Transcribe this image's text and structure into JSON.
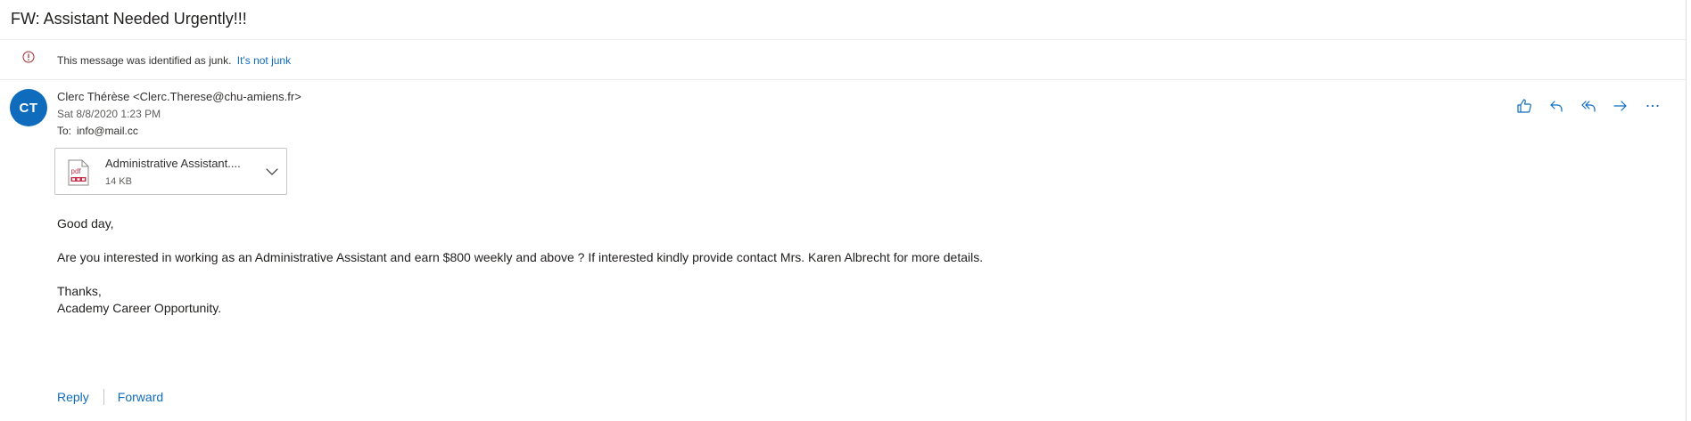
{
  "message": {
    "subject": "FW: Assistant Needed Urgently!!!",
    "junk_notice": {
      "text": "This message was identified as junk.",
      "link": "It's not junk",
      "icon": "info-icon"
    },
    "sender": {
      "initials": "CT",
      "display": "Clerc Thérèse <Clerc.Therese@chu-amiens.fr>",
      "avatar_color": "#0f6cbd"
    },
    "date": "Sat 8/8/2020 1:23 PM",
    "to": {
      "label": "To:",
      "address": "info@mail.cc"
    },
    "actions": [
      {
        "icon": "like-icon"
      },
      {
        "icon": "reply-icon"
      },
      {
        "icon": "reply-all-icon"
      },
      {
        "icon": "forward-icon"
      },
      {
        "icon": "more-icon"
      }
    ],
    "attachment": {
      "name": "Administrative Assistant....",
      "size": "14 KB",
      "icon": "pdf-file-icon"
    },
    "body": {
      "greeting": "Good day,",
      "paragraph": "Are you interested in working as an Administrative Assistant and earn $800 weekly and above ? If interested kindly provide contact Mrs. Karen Albrecht for more details.",
      "closing": "Thanks,",
      "signature": "Academy Career Opportunity."
    },
    "footer": {
      "reply": "Reply",
      "forward": "Forward"
    }
  },
  "colors": {
    "accent": "#0f6cbd",
    "junk_icon": "#a4262c",
    "pdf": "#c4314b"
  }
}
